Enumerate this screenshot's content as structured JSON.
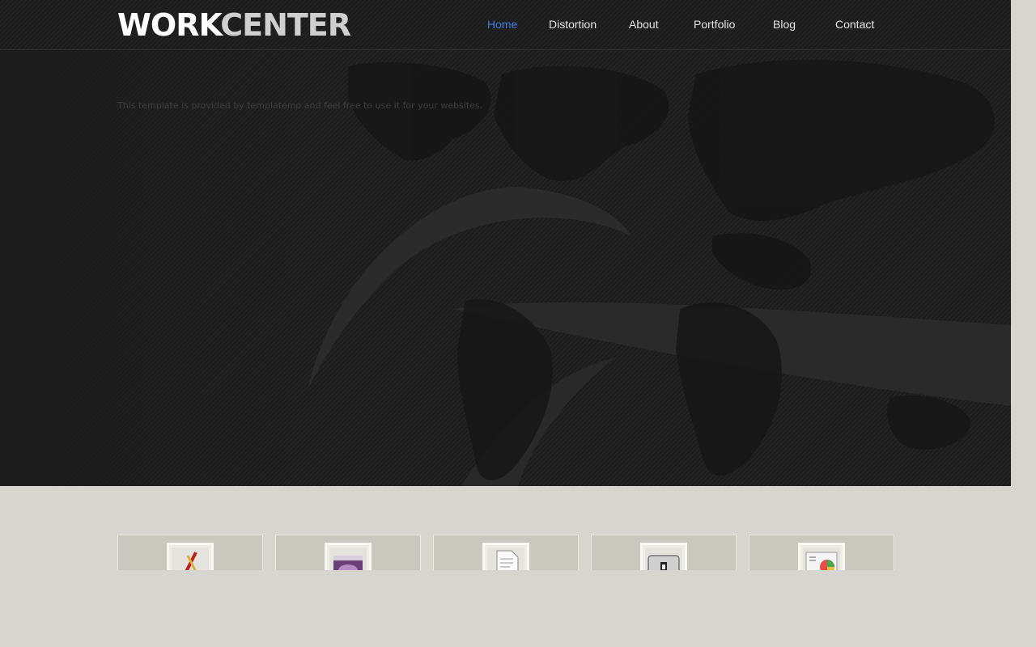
{
  "site": {
    "logo_primary": "WORK",
    "logo_secondary": "CENTER"
  },
  "nav": {
    "items": [
      {
        "label": "Home",
        "active": true
      },
      {
        "label": "Distortion",
        "active": false
      },
      {
        "label": "About",
        "active": false
      },
      {
        "label": "Portfolio",
        "active": false
      },
      {
        "label": "Blog",
        "active": false
      },
      {
        "label": "Contact",
        "active": false
      }
    ]
  },
  "hero": {
    "text": "This template is provided by templatemo and feel free to use it for your websites."
  },
  "services": {
    "cards": [
      {
        "icon": "pencil-ruler-icon"
      },
      {
        "icon": "media-window-icon"
      },
      {
        "icon": "document-icon"
      },
      {
        "icon": "switch-icon"
      },
      {
        "icon": "chart-icon"
      }
    ]
  },
  "colors": {
    "accent": "#3c7ee6",
    "header_bg": "#1e1e1e",
    "content_bg": "#d6d5cf"
  }
}
